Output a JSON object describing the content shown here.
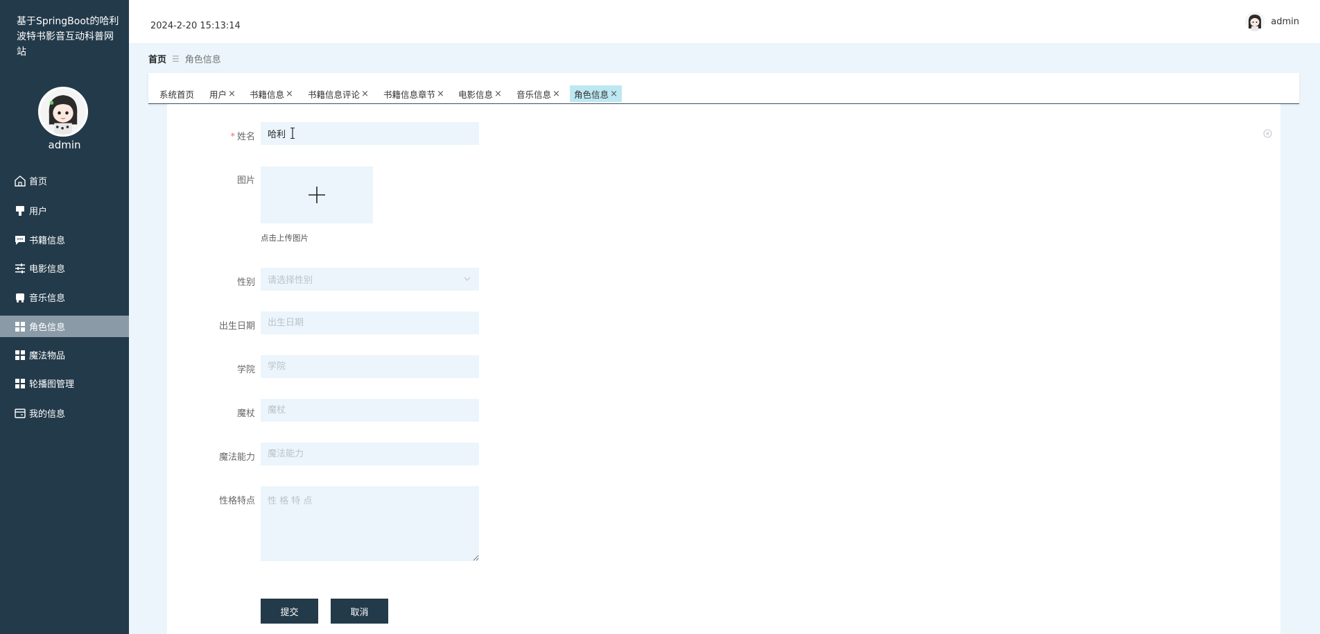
{
  "app": {
    "title": "基于SpringBoot的哈利波特书影音互动科普网站"
  },
  "sidebar": {
    "username": "admin",
    "items": [
      {
        "label": "首页",
        "icon": "home-icon"
      },
      {
        "label": "用户",
        "icon": "user-icon"
      },
      {
        "label": "书籍信息",
        "icon": "chat-icon"
      },
      {
        "label": "电影信息",
        "icon": "sliders-icon"
      },
      {
        "label": "音乐信息",
        "icon": "box-icon"
      },
      {
        "label": "角色信息",
        "icon": "grid-icon",
        "active": true
      },
      {
        "label": "魔法物品",
        "icon": "grid-icon"
      },
      {
        "label": "轮播图管理",
        "icon": "grid-icon"
      },
      {
        "label": "我的信息",
        "icon": "card-icon"
      }
    ]
  },
  "header": {
    "datetime": "2024-2-20 15:13:14",
    "username": "admin"
  },
  "breadcrumb": {
    "home": "首页",
    "separator": "☰",
    "current": "角色信息"
  },
  "tabs": [
    {
      "label": "系统首页",
      "closable": false
    },
    {
      "label": "用户",
      "closable": true
    },
    {
      "label": "书籍信息",
      "closable": true
    },
    {
      "label": "书籍信息评论",
      "closable": true
    },
    {
      "label": "书籍信息章节",
      "closable": true
    },
    {
      "label": "电影信息",
      "closable": true
    },
    {
      "label": "音乐信息",
      "closable": true
    },
    {
      "label": "角色信息",
      "closable": true,
      "active": true
    }
  ],
  "tab_close_glyph": "×",
  "form": {
    "name": {
      "label": "姓名",
      "required_mark": "*",
      "value": "哈利"
    },
    "image": {
      "label": "图片",
      "tip": "点击上传图片"
    },
    "gender": {
      "label": "性别",
      "placeholder": "请选择性别"
    },
    "birthdate": {
      "label": "出生日期",
      "placeholder": "出生日期"
    },
    "college": {
      "label": "学院",
      "placeholder": "学院"
    },
    "wand": {
      "label": "魔杖",
      "placeholder": "魔杖"
    },
    "magic": {
      "label": "魔法能力",
      "placeholder": "魔法能力"
    },
    "traits": {
      "label": "性格特点",
      "placeholder": "性 格 特 点"
    },
    "submit_label": "提交",
    "cancel_label": "取消"
  },
  "colors": {
    "sidebar_bg": "#233a4a",
    "active_menu_bg": "#8a9ba7",
    "main_bg": "#ebf5fb",
    "active_tab_bg": "#bde8f2",
    "button_bg": "#233a4a",
    "required": "#f56c6c"
  }
}
